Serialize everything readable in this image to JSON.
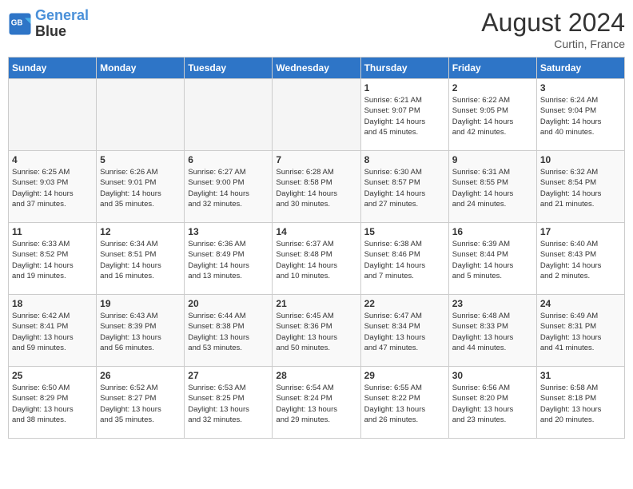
{
  "header": {
    "logo_line1": "General",
    "logo_line2": "Blue",
    "month_year": "August 2024",
    "location": "Curtin, France"
  },
  "days_of_week": [
    "Sunday",
    "Monday",
    "Tuesday",
    "Wednesday",
    "Thursday",
    "Friday",
    "Saturday"
  ],
  "weeks": [
    [
      {
        "day": "",
        "info": ""
      },
      {
        "day": "",
        "info": ""
      },
      {
        "day": "",
        "info": ""
      },
      {
        "day": "",
        "info": ""
      },
      {
        "day": "1",
        "info": "Sunrise: 6:21 AM\nSunset: 9:07 PM\nDaylight: 14 hours\nand 45 minutes."
      },
      {
        "day": "2",
        "info": "Sunrise: 6:22 AM\nSunset: 9:05 PM\nDaylight: 14 hours\nand 42 minutes."
      },
      {
        "day": "3",
        "info": "Sunrise: 6:24 AM\nSunset: 9:04 PM\nDaylight: 14 hours\nand 40 minutes."
      }
    ],
    [
      {
        "day": "4",
        "info": "Sunrise: 6:25 AM\nSunset: 9:03 PM\nDaylight: 14 hours\nand 37 minutes."
      },
      {
        "day": "5",
        "info": "Sunrise: 6:26 AM\nSunset: 9:01 PM\nDaylight: 14 hours\nand 35 minutes."
      },
      {
        "day": "6",
        "info": "Sunrise: 6:27 AM\nSunset: 9:00 PM\nDaylight: 14 hours\nand 32 minutes."
      },
      {
        "day": "7",
        "info": "Sunrise: 6:28 AM\nSunset: 8:58 PM\nDaylight: 14 hours\nand 30 minutes."
      },
      {
        "day": "8",
        "info": "Sunrise: 6:30 AM\nSunset: 8:57 PM\nDaylight: 14 hours\nand 27 minutes."
      },
      {
        "day": "9",
        "info": "Sunrise: 6:31 AM\nSunset: 8:55 PM\nDaylight: 14 hours\nand 24 minutes."
      },
      {
        "day": "10",
        "info": "Sunrise: 6:32 AM\nSunset: 8:54 PM\nDaylight: 14 hours\nand 21 minutes."
      }
    ],
    [
      {
        "day": "11",
        "info": "Sunrise: 6:33 AM\nSunset: 8:52 PM\nDaylight: 14 hours\nand 19 minutes."
      },
      {
        "day": "12",
        "info": "Sunrise: 6:34 AM\nSunset: 8:51 PM\nDaylight: 14 hours\nand 16 minutes."
      },
      {
        "day": "13",
        "info": "Sunrise: 6:36 AM\nSunset: 8:49 PM\nDaylight: 14 hours\nand 13 minutes."
      },
      {
        "day": "14",
        "info": "Sunrise: 6:37 AM\nSunset: 8:48 PM\nDaylight: 14 hours\nand 10 minutes."
      },
      {
        "day": "15",
        "info": "Sunrise: 6:38 AM\nSunset: 8:46 PM\nDaylight: 14 hours\nand 7 minutes."
      },
      {
        "day": "16",
        "info": "Sunrise: 6:39 AM\nSunset: 8:44 PM\nDaylight: 14 hours\nand 5 minutes."
      },
      {
        "day": "17",
        "info": "Sunrise: 6:40 AM\nSunset: 8:43 PM\nDaylight: 14 hours\nand 2 minutes."
      }
    ],
    [
      {
        "day": "18",
        "info": "Sunrise: 6:42 AM\nSunset: 8:41 PM\nDaylight: 13 hours\nand 59 minutes."
      },
      {
        "day": "19",
        "info": "Sunrise: 6:43 AM\nSunset: 8:39 PM\nDaylight: 13 hours\nand 56 minutes."
      },
      {
        "day": "20",
        "info": "Sunrise: 6:44 AM\nSunset: 8:38 PM\nDaylight: 13 hours\nand 53 minutes."
      },
      {
        "day": "21",
        "info": "Sunrise: 6:45 AM\nSunset: 8:36 PM\nDaylight: 13 hours\nand 50 minutes."
      },
      {
        "day": "22",
        "info": "Sunrise: 6:47 AM\nSunset: 8:34 PM\nDaylight: 13 hours\nand 47 minutes."
      },
      {
        "day": "23",
        "info": "Sunrise: 6:48 AM\nSunset: 8:33 PM\nDaylight: 13 hours\nand 44 minutes."
      },
      {
        "day": "24",
        "info": "Sunrise: 6:49 AM\nSunset: 8:31 PM\nDaylight: 13 hours\nand 41 minutes."
      }
    ],
    [
      {
        "day": "25",
        "info": "Sunrise: 6:50 AM\nSunset: 8:29 PM\nDaylight: 13 hours\nand 38 minutes."
      },
      {
        "day": "26",
        "info": "Sunrise: 6:52 AM\nSunset: 8:27 PM\nDaylight: 13 hours\nand 35 minutes."
      },
      {
        "day": "27",
        "info": "Sunrise: 6:53 AM\nSunset: 8:25 PM\nDaylight: 13 hours\nand 32 minutes."
      },
      {
        "day": "28",
        "info": "Sunrise: 6:54 AM\nSunset: 8:24 PM\nDaylight: 13 hours\nand 29 minutes."
      },
      {
        "day": "29",
        "info": "Sunrise: 6:55 AM\nSunset: 8:22 PM\nDaylight: 13 hours\nand 26 minutes."
      },
      {
        "day": "30",
        "info": "Sunrise: 6:56 AM\nSunset: 8:20 PM\nDaylight: 13 hours\nand 23 minutes."
      },
      {
        "day": "31",
        "info": "Sunrise: 6:58 AM\nSunset: 8:18 PM\nDaylight: 13 hours\nand 20 minutes."
      }
    ]
  ]
}
